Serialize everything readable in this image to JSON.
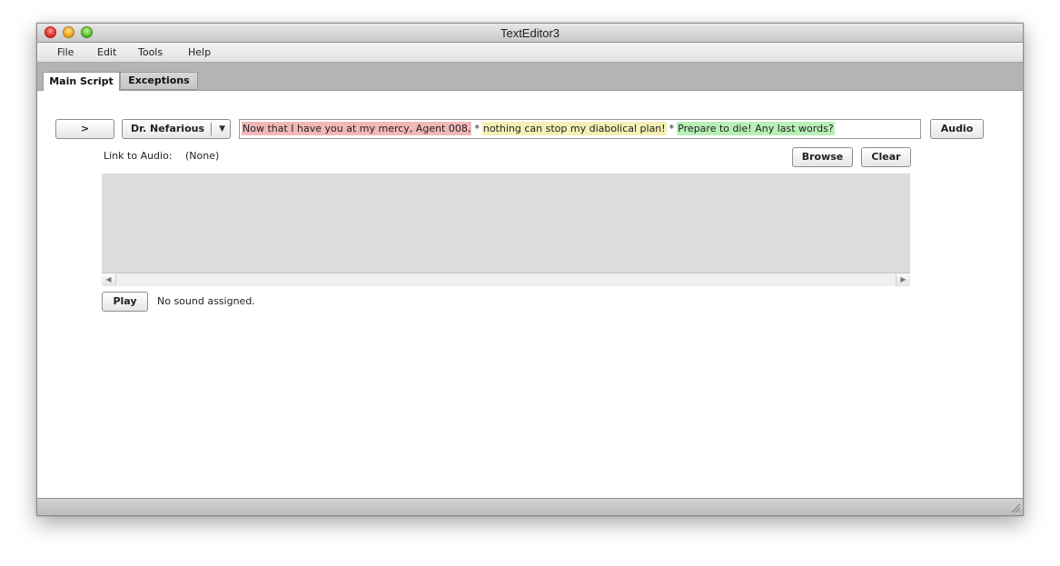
{
  "window": {
    "title": "TextEditor3"
  },
  "menubar": {
    "items": [
      "File",
      "Edit",
      "Tools",
      "Help"
    ]
  },
  "tabs": [
    {
      "label": "Main Script",
      "active": true
    },
    {
      "label": "Exceptions",
      "active": false
    }
  ],
  "script_row": {
    "expand_label": ">",
    "character": "Dr. Nefarious",
    "segments": [
      {
        "text": "Now that I have you at my mercy, Agent 008,",
        "color": "#f2b8b8"
      },
      {
        "text": "nothing can stop my diabolical plan!",
        "color": "#f4f0b6"
      },
      {
        "text": "Prepare to die! Any last words?",
        "color": "#b8f0b8"
      }
    ],
    "separator": "*",
    "audio_label": "Audio"
  },
  "audio_link": {
    "label": "Link to Audio:",
    "value": "(None)",
    "browse_label": "Browse",
    "clear_label": "Clear"
  },
  "playback": {
    "play_label": "Play",
    "status": "No sound assigned."
  },
  "icons": {
    "dropdown": "chevron-down-icon",
    "scroll_left": "scroll-left-icon",
    "scroll_right": "scroll-right-icon",
    "resize": "resize-grip-icon"
  }
}
